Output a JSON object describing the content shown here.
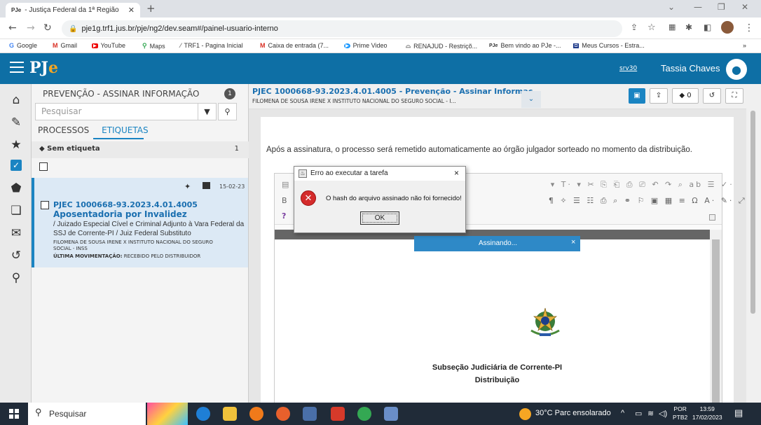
{
  "browser": {
    "tab_title": "- Justiça Federal da 1ª Região",
    "tab_favicon": "PJe",
    "url": "pje1g.trf1.jus.br/pje/ng2/dev.seam#/painel-usuario-interno",
    "bookmarks": [
      {
        "icon": "google-icon",
        "label": "Google"
      },
      {
        "icon": "gmail-icon",
        "label": "Gmail"
      },
      {
        "icon": "youtube-icon",
        "label": "YouTube"
      },
      {
        "icon": "maps-icon",
        "label": "Maps"
      },
      {
        "icon": "trf1-icon",
        "label": "TRF1 - Pagina Inicial"
      },
      {
        "icon": "gmail-icon",
        "label": "Caixa de entrada (7..."
      },
      {
        "icon": "prime-icon",
        "label": "Prime Video"
      },
      {
        "icon": "renajud-icon",
        "label": "RENAJUD - Restriçõ..."
      },
      {
        "icon": "pje-icon",
        "label": "Bem vindo ao PJe -..."
      },
      {
        "icon": "cursos-icon",
        "label": "Meus Cursos - Estra..."
      }
    ],
    "more_bookmarks": "»"
  },
  "header": {
    "logo_main": "PJ",
    "logo_accent": "e",
    "server": "srv30",
    "user_name": "Tassia Chaves"
  },
  "left_panel": {
    "title": "PREVENÇÃO - ASSINAR INFORMAÇÃO",
    "count": "1",
    "search_placeholder": "Pesquisar",
    "tab_processos": "PROCESSOS",
    "tab_etiquetas": "ETIQUETAS",
    "tag_label": "Sem etiqueta",
    "tag_count": "1",
    "card": {
      "date": "15-02-23",
      "process_number": "PJEC 1000668-93.2023.4.01.4005",
      "process_class": "Aposentadoria por Invalidez",
      "court": "/ Juizado Especial Cível e Criminal Adjunto à Vara Federal da SSJ de Corrente-PI / Juiz Federal Substituto",
      "parties": "FILOMENA DE SOUSA IRENE X INSTITUTO NACIONAL DO SEGURO SOCIAL - INSS",
      "last_move_label": "ÚLTIMA MOVIMENTAÇÃO:",
      "last_move": "RECEBIDO PELO DISTRIBUIDOR"
    }
  },
  "main": {
    "title": "PJEC 1000668-93.2023.4.01.4005 - Prevenção - Assinar Informaç...",
    "subtitle": "FILOMENA DE SOUSA IRENE X INSTITUTO NACIONAL DO SEGURO SOCIAL - I...",
    "tag_count": "0",
    "notice": "Após a assinatura, o processo será remetido automaticamente ao órgão julgador sorteado no momento da distribuição.",
    "doc_line1": "Subseção Judiciária de Corrente-PI",
    "doc_line2": "Distribuição"
  },
  "signing": {
    "label": "Assinando...",
    "close": "×"
  },
  "dialog": {
    "title": "Erro ao executar a tarefa",
    "message": "O hash do arquivo assinado não foi fornecido!",
    "ok": "OK",
    "close": "×"
  },
  "taskbar": {
    "search": "Pesquisar",
    "weather": "30°C  Parc ensolarado",
    "lang_top": "POR",
    "lang_bottom": "PTB2",
    "time": "13:59",
    "date": "17/02/2023"
  },
  "colors": {
    "header_blue": "#0e6fa5",
    "link_blue": "#1a6fb0",
    "accent_orange": "#f5a623",
    "error_red": "#d42b2b"
  }
}
